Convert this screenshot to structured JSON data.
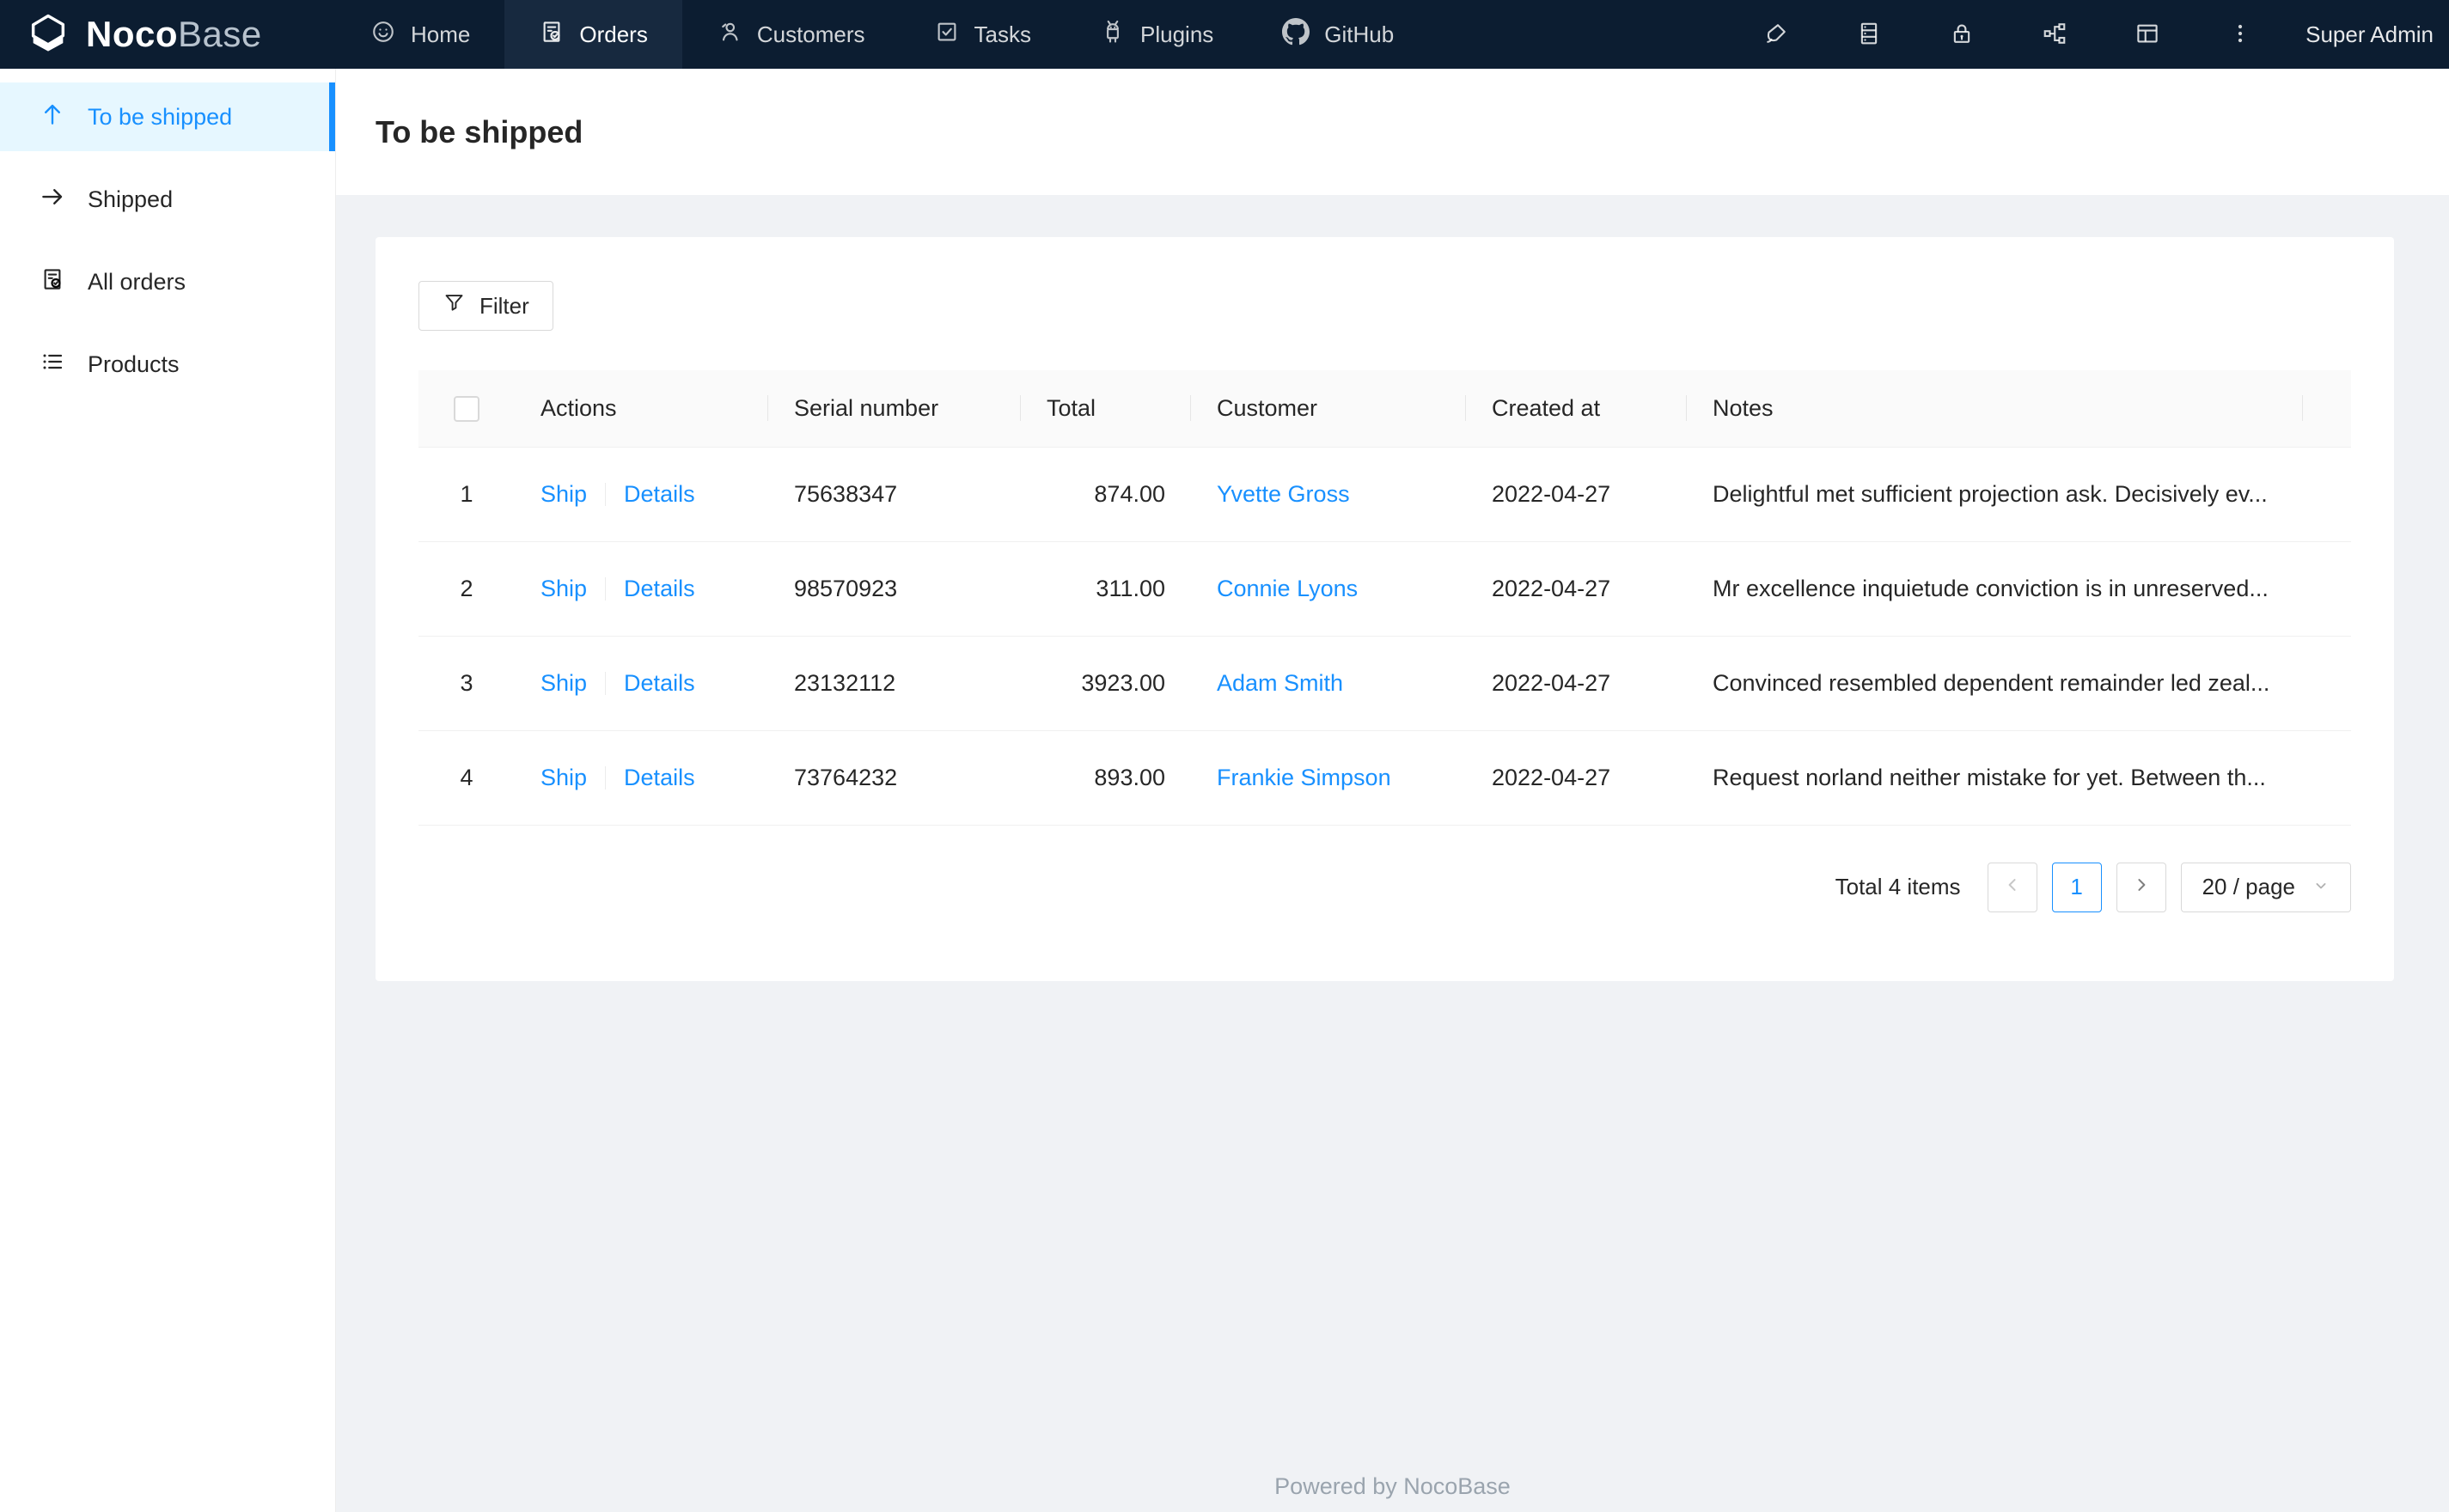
{
  "nav": {
    "logo": {
      "text_bold": "Noco",
      "text_light": "Base",
      "icon": "nocobase-logo-icon"
    },
    "items": [
      {
        "label": "Home",
        "icon": "smile-icon",
        "active": false
      },
      {
        "label": "Orders",
        "icon": "file-done-icon",
        "active": true
      },
      {
        "label": "Customers",
        "icon": "user-icon",
        "active": false
      },
      {
        "label": "Tasks",
        "icon": "check-square-icon",
        "active": false
      },
      {
        "label": "Plugins",
        "icon": "robot-icon",
        "active": false
      },
      {
        "label": "GitHub",
        "icon": "github-icon",
        "active": false
      }
    ],
    "tools": [
      {
        "icon": "highlight-pen-icon"
      },
      {
        "icon": "database-icon"
      },
      {
        "icon": "lock-icon"
      },
      {
        "icon": "cluster-icon"
      },
      {
        "icon": "layout-icon"
      },
      {
        "icon": "ellipsis-vertical-icon"
      }
    ],
    "user": "Super Admin"
  },
  "sidebar": {
    "items": [
      {
        "label": "To be shipped",
        "icon": "arrow-up-icon",
        "active": true
      },
      {
        "label": "Shipped",
        "icon": "arrow-right-icon",
        "active": false
      },
      {
        "label": "All orders",
        "icon": "file-done-icon",
        "active": false
      },
      {
        "label": "Products",
        "icon": "unordered-list-icon",
        "active": false
      }
    ]
  },
  "page": {
    "title": "To be shipped"
  },
  "toolbar": {
    "filter_label": "Filter",
    "filter_icon": "filter-funnel-icon"
  },
  "table": {
    "columns": [
      "",
      "Actions",
      "Serial number",
      "Total",
      "Customer",
      "Created at",
      "Notes"
    ],
    "action_labels": {
      "ship": "Ship",
      "details": "Details"
    },
    "rows": [
      {
        "index": "1",
        "serial": "75638347",
        "total": "874.00",
        "customer": "Yvette Gross",
        "created_at": "2022-04-27",
        "notes": "Delightful met sufficient projection ask. Decisively ev..."
      },
      {
        "index": "2",
        "serial": "98570923",
        "total": "311.00",
        "customer": "Connie Lyons",
        "created_at": "2022-04-27",
        "notes": "Mr excellence inquietude conviction is in unreserved..."
      },
      {
        "index": "3",
        "serial": "23132112",
        "total": "3923.00",
        "customer": "Adam Smith",
        "created_at": "2022-04-27",
        "notes": "Convinced resembled dependent remainder led zeal..."
      },
      {
        "index": "4",
        "serial": "73764232",
        "total": "893.00",
        "customer": "Frankie Simpson",
        "created_at": "2022-04-27",
        "notes": "Request norland neither mistake for yet. Between th..."
      }
    ]
  },
  "pagination": {
    "total_text": "Total 4 items",
    "current_page": "1",
    "page_size": "20 / page"
  },
  "footer": {
    "text": "Powered by NocoBase"
  },
  "colors": {
    "accent": "#1890ff",
    "nav_bg": "#0c1d31",
    "nav_active_bg": "#17293f",
    "sidebar_selected_bg": "#e6f7ff",
    "content_bg": "#f0f2f5",
    "table_header_bg": "#fafafa"
  }
}
